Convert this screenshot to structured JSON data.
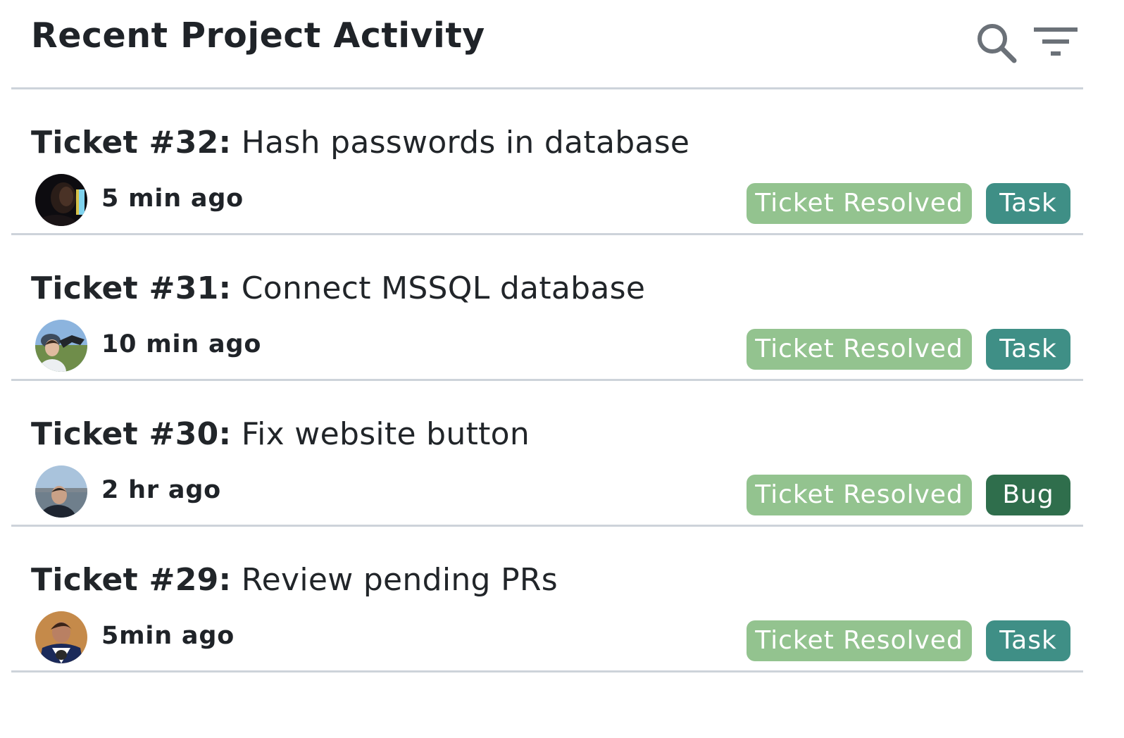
{
  "header": {
    "title": "Recent Project Activity",
    "search_icon": "search-icon",
    "filter_icon": "filter-icon"
  },
  "colors": {
    "status_resolved": "#93c38f",
    "type_task": "#3f8f86",
    "type_bug": "#2f6e4c",
    "divider": "#cdd3da",
    "icon": "#6b7178"
  },
  "activities": [
    {
      "ticket_label": "Ticket #32:",
      "summary": "Hash passwords in database",
      "time": "5 min ago",
      "status": "Ticket Resolved",
      "type": "Task",
      "type_color": "#3f8f86",
      "avatar": "avatar-dark-silhouette"
    },
    {
      "ticket_label": "Ticket #31:",
      "summary": "Connect MSSQL database",
      "time": "10 min ago",
      "status": "Ticket Resolved",
      "type": "Task",
      "type_color": "#3f8f86",
      "avatar": "avatar-outdoor-dinosaur"
    },
    {
      "ticket_label": "Ticket #30:",
      "summary": "Fix website button",
      "time": "2 hr ago",
      "status": "Ticket Resolved",
      "type": "Bug",
      "type_color": "#2f6e4c",
      "avatar": "avatar-waterfront"
    },
    {
      "ticket_label": "Ticket #29:",
      "summary": "Review pending PRs",
      "time": "5min ago",
      "status": "Ticket Resolved",
      "type": "Task",
      "type_color": "#3f8f86",
      "avatar": "avatar-jersey"
    }
  ]
}
